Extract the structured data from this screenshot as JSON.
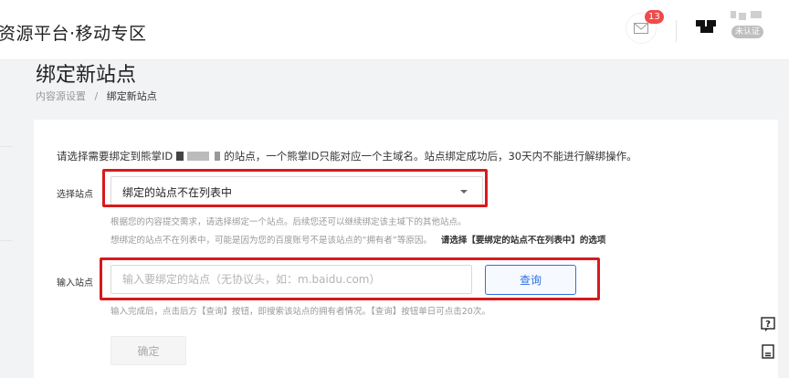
{
  "header": {
    "brand": "资源平台·移动专区",
    "message_count": "13",
    "auth_status": "未认证"
  },
  "page": {
    "title": "绑定新站点",
    "breadcrumb": [
      {
        "label": "内容源设置"
      },
      {
        "separator": "/"
      },
      {
        "label": "绑定新站点"
      }
    ]
  },
  "form": {
    "notice_prefix": "请选择需要绑定到熊掌ID",
    "notice_suffix": "的站点，一个熊掌ID只能对应一个主域名。站点绑定成功后，30天内不能进行解绑操作。",
    "select_label": "选择站点",
    "select_value": "绑定的站点不在列表中",
    "select_help_1": "根据您的内容提交需求，请选择绑定一个站点。后续您还可以继续绑定该主域下的其他站点。",
    "select_help_2": "想绑定的站点不在列表中，可能是因为您的百度账号不是该站点的“拥有者”等原因。",
    "select_help_2_strong": "请选择【要绑定的站点不在列表中】的选项",
    "input_label": "输入站点",
    "input_placeholder": "输入要绑定的站点（无协议头，如：m.baidu.com）",
    "input_value": "",
    "query_button": "查询",
    "input_help": "输入完成后，点击后方【查询】按钮，即搜索该站点的拥有者情况。【查询】按钮单日可点击20次。",
    "confirm_button": "确定"
  },
  "icons": {
    "message": "envelope-icon",
    "help": "question-icon",
    "feedback": "document-icon"
  },
  "colors": {
    "highlight": "#d8191e",
    "primary": "#2f6fe6",
    "badge": "#f04a4a"
  }
}
